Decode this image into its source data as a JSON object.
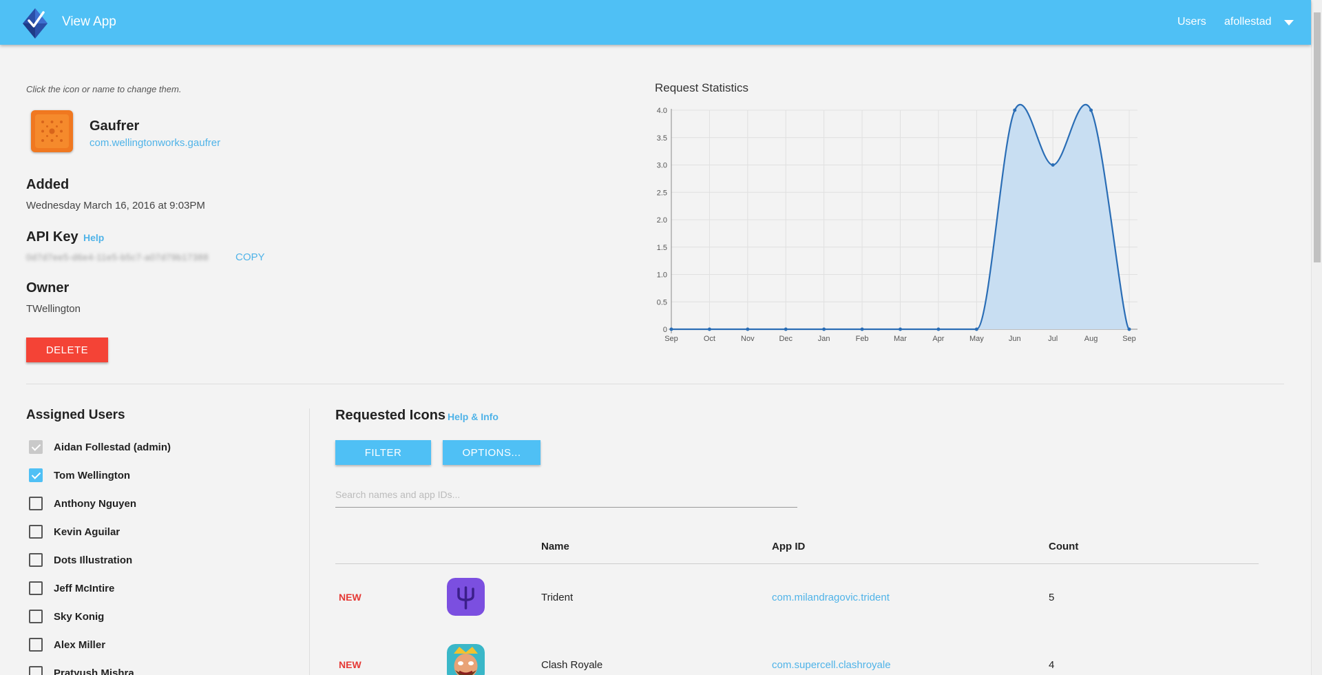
{
  "header": {
    "title": "View App",
    "nav_users": "Users",
    "account": "afollestad"
  },
  "app": {
    "hint": "Click the icon or name to change them.",
    "name": "Gaufrer",
    "bundle_id": "com.wellingtonworks.gaufrer",
    "added_label": "Added",
    "added_value": "Wednesday March 16, 2016 at 9:03PM",
    "api_key_label": "API Key",
    "api_key_help": "Help",
    "api_key_value": "0d7d7ee5-d6e4-11e5-b5c7-a07d79b17388",
    "copy_label": "COPY",
    "owner_label": "Owner",
    "owner_value": "TWellington",
    "delete_label": "DELETE",
    "icon_color": "#f07820"
  },
  "chart_data": {
    "type": "area",
    "title": "Request Statistics",
    "categories": [
      "Sep",
      "Oct",
      "Nov",
      "Dec",
      "Jan",
      "Feb",
      "Mar",
      "Apr",
      "May",
      "Jun",
      "Jul",
      "Aug",
      "Sep"
    ],
    "values": [
      0,
      0,
      0,
      0,
      0,
      0,
      0,
      0,
      0,
      4,
      3,
      4,
      0
    ],
    "ylim": [
      0,
      4.0
    ],
    "yticks": [
      "0",
      "0.5",
      "1.0",
      "1.5",
      "2.0",
      "2.5",
      "3.0",
      "3.5",
      "4.0"
    ],
    "grid": true,
    "line_color": "#2a6db5",
    "fill_color": "#c8def2"
  },
  "assigned_users": {
    "title": "Assigned Users",
    "users": [
      {
        "name": "Aidan Follestad (admin)",
        "state": "disabled"
      },
      {
        "name": "Tom Wellington",
        "state": "checked"
      },
      {
        "name": "Anthony Nguyen",
        "state": "unchecked"
      },
      {
        "name": "Kevin Aguilar",
        "state": "unchecked"
      },
      {
        "name": "Dots Illustration",
        "state": "unchecked"
      },
      {
        "name": "Jeff McIntire",
        "state": "unchecked"
      },
      {
        "name": "Sky Konig",
        "state": "unchecked"
      },
      {
        "name": "Alex Miller",
        "state": "unchecked"
      },
      {
        "name": "Pratyush Mishra",
        "state": "unchecked"
      }
    ]
  },
  "requested_icons": {
    "title": "Requested Icons",
    "help_label": "Help & Info",
    "filter_label": "FILTER",
    "options_label": "OPTIONS...",
    "search_placeholder": "Search names and app IDs...",
    "columns": [
      "Name",
      "App ID",
      "Count"
    ],
    "rows": [
      {
        "badge": "NEW",
        "name": "Trident",
        "app_id": "com.milandragovic.trident",
        "count": "5",
        "icon": "trident-icon",
        "icon_color": "#7b4fe0"
      },
      {
        "badge": "NEW",
        "name": "Clash Royale",
        "app_id": "com.supercell.clashroyale",
        "count": "4",
        "icon": "clash-royale-icon",
        "icon_color": "#3ab7c8"
      }
    ]
  }
}
